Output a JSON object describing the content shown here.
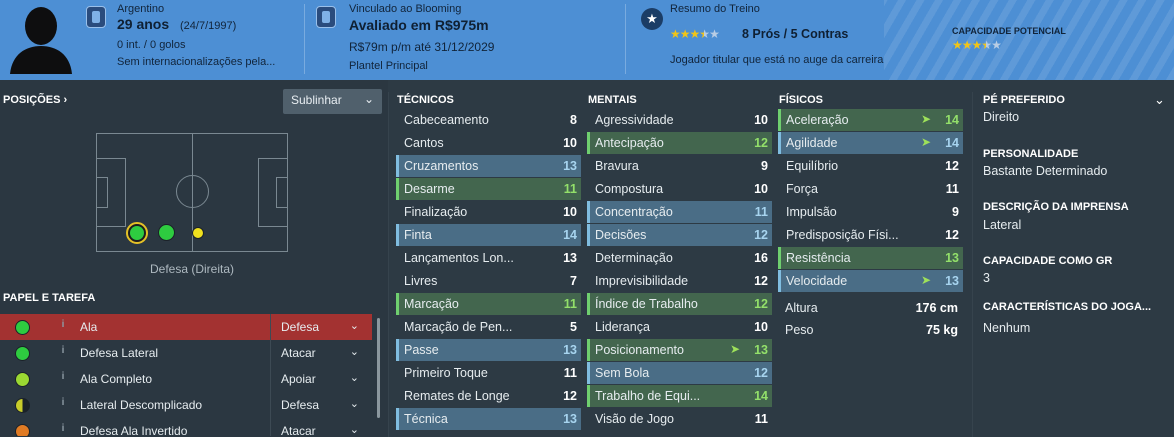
{
  "header": {
    "nationality": "Argentino",
    "age": "29 anos",
    "dob": "(24/7/1997)",
    "caps": "0 int. / 0 golos",
    "intl_status": "Sem internacionalizações pela...",
    "contract_club": "Vinculado ao Blooming",
    "value": "Avaliado em R$975m",
    "wage": "R$79m p/m até 31/12/2029",
    "squad_status": "Plantel Principal",
    "training_title": "Resumo do Treino",
    "training_stars": 3.5,
    "pros_cons": "8 Prós / 5 Contras",
    "training_note": "Jogador titular que está no auge da carreira",
    "potential_label": "CAPACIDADE POTENCIAL",
    "potential_stars": 3.5,
    "colors": {
      "bar": "#4d8fd4",
      "star": "#f0c419"
    }
  },
  "positions": {
    "title": "POSIÇÕES ›",
    "dropdown_label": "Sublinhar",
    "position_label": "Defesa (Direita)"
  },
  "roles": {
    "title": "PAPEL E TAREFA",
    "items": [
      {
        "name": "Ala",
        "duty": "Defesa",
        "selected": true,
        "color": "#2ecc40"
      },
      {
        "name": "Defesa Lateral",
        "duty": "Atacar",
        "selected": false,
        "color": "#2ecc40"
      },
      {
        "name": "Ala Completo",
        "duty": "Apoiar",
        "selected": false,
        "color": "#9bd832"
      },
      {
        "name": "Lateral Descomplicado",
        "duty": "Defesa",
        "selected": false,
        "color": "#c8cc2a"
      },
      {
        "name": "Defesa Ala Invertido",
        "duty": "Atacar",
        "selected": false,
        "color": "#e07b24"
      }
    ]
  },
  "technical": {
    "title": "TÉCNICOS",
    "items": [
      {
        "name": "Cabeceamento",
        "value": "8",
        "hl": ""
      },
      {
        "name": "Cantos",
        "value": "10",
        "hl": ""
      },
      {
        "name": "Cruzamentos",
        "value": "13",
        "hl": "b"
      },
      {
        "name": "Desarme",
        "value": "11",
        "hl": "g"
      },
      {
        "name": "Finalização",
        "value": "10",
        "hl": ""
      },
      {
        "name": "Finta",
        "value": "14",
        "hl": "b"
      },
      {
        "name": "Lançamentos Lon...",
        "value": "13",
        "hl": ""
      },
      {
        "name": "Livres",
        "value": "7",
        "hl": ""
      },
      {
        "name": "Marcação",
        "value": "11",
        "hl": "g"
      },
      {
        "name": "Marcação de Pen...",
        "value": "5",
        "hl": ""
      },
      {
        "name": "Passe",
        "value": "13",
        "hl": "b"
      },
      {
        "name": "Primeiro Toque",
        "value": "11",
        "hl": ""
      },
      {
        "name": "Remates de Longe",
        "value": "12",
        "hl": ""
      },
      {
        "name": "Técnica",
        "value": "13",
        "hl": "b"
      }
    ]
  },
  "mental": {
    "title": "MENTAIS",
    "items": [
      {
        "name": "Agressividade",
        "value": "10",
        "hl": ""
      },
      {
        "name": "Antecipação",
        "value": "12",
        "hl": "g"
      },
      {
        "name": "Bravura",
        "value": "9",
        "hl": ""
      },
      {
        "name": "Compostura",
        "value": "10",
        "hl": ""
      },
      {
        "name": "Concentração",
        "value": "11",
        "hl": "b"
      },
      {
        "name": "Decisões",
        "value": "12",
        "hl": "b"
      },
      {
        "name": "Determinação",
        "value": "16",
        "hl": ""
      },
      {
        "name": "Imprevisibilidade",
        "value": "12",
        "hl": ""
      },
      {
        "name": "Índice de Trabalho",
        "value": "12",
        "hl": "g"
      },
      {
        "name": "Liderança",
        "value": "10",
        "hl": ""
      },
      {
        "name": "Posicionamento",
        "value": "13",
        "hl": "g",
        "arrow": true
      },
      {
        "name": "Sem Bola",
        "value": "12",
        "hl": "b"
      },
      {
        "name": "Trabalho de Equi...",
        "value": "14",
        "hl": "g"
      },
      {
        "name": "Visão de Jogo",
        "value": "11",
        "hl": ""
      }
    ]
  },
  "physical": {
    "title": "FÍSICOS",
    "items": [
      {
        "name": "Aceleração",
        "value": "14",
        "hl": "g",
        "arrow": true
      },
      {
        "name": "Agilidade",
        "value": "14",
        "hl": "b",
        "arrow": true
      },
      {
        "name": "Equilíbrio",
        "value": "12",
        "hl": ""
      },
      {
        "name": "Força",
        "value": "11",
        "hl": ""
      },
      {
        "name": "Impulsão",
        "value": "9",
        "hl": ""
      },
      {
        "name": "Predisposição Físi...",
        "value": "12",
        "hl": ""
      },
      {
        "name": "Resistência",
        "value": "13",
        "hl": "g"
      },
      {
        "name": "Velocidade",
        "value": "13",
        "hl": "b",
        "arrow": true
      }
    ],
    "height_label": "Altura",
    "height_value": "176 cm",
    "weight_label": "Peso",
    "weight_value": "75 kg"
  },
  "info": {
    "foot_label": "PÉ PREFERIDO",
    "foot_value": "Direito",
    "personality_label": "PERSONALIDADE",
    "personality_value": "Bastante Determinado",
    "press_label": "DESCRIÇÃO DA IMPRENSA",
    "press_value": "Lateral",
    "gk_label": "CAPACIDADE COMO GR",
    "gk_value": "3",
    "traits_label": "CARACTERÍSTICAS DO JOGA...",
    "traits_value": "Nenhum"
  }
}
